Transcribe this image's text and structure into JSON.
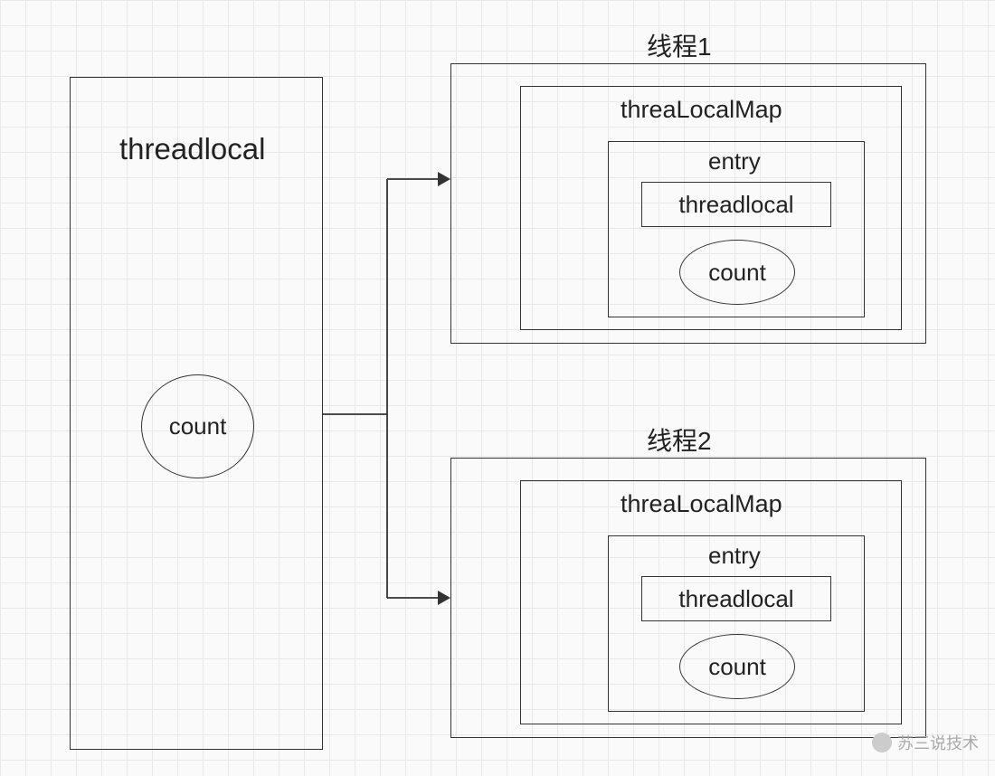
{
  "left_box": {
    "title": "threadlocal",
    "count_label": "count"
  },
  "thread1": {
    "title": "线程1",
    "map_label": "threaLocalMap",
    "entry_label": "entry",
    "tl_label": "threadlocal",
    "count_label": "count"
  },
  "thread2": {
    "title": "线程2",
    "map_label": "threaLocalMap",
    "entry_label": "entry",
    "tl_label": "threadlocal",
    "count_label": "count"
  },
  "watermark": "苏三说技术"
}
